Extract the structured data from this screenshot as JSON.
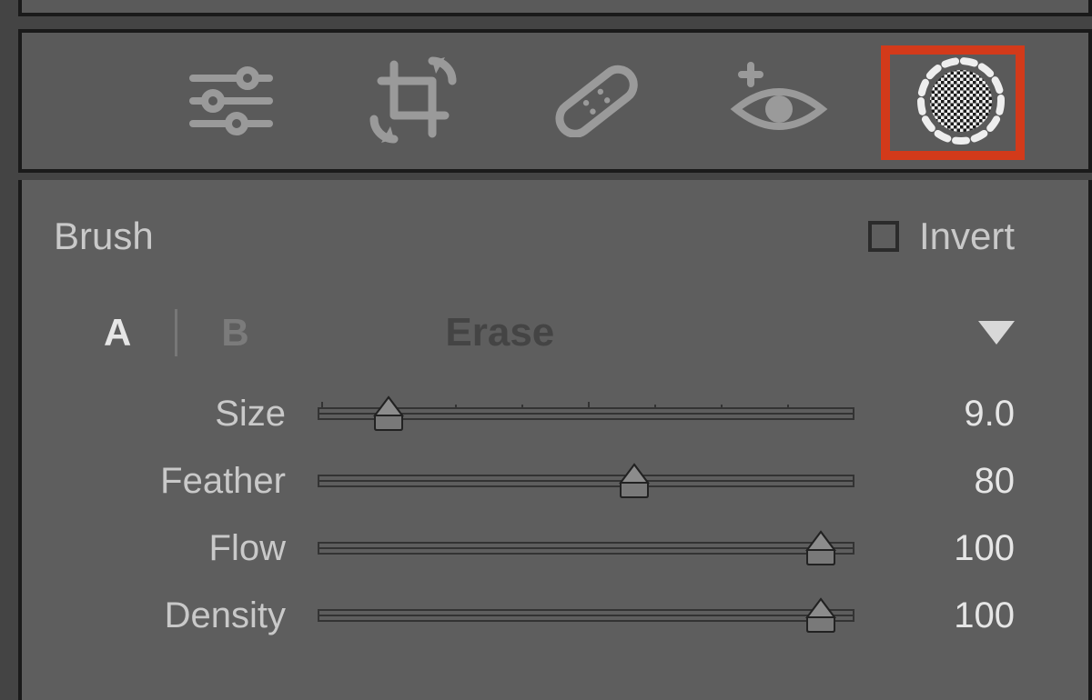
{
  "panel_title": "Brush",
  "invert": {
    "label": "Invert",
    "checked": false
  },
  "modes": {
    "a": "A",
    "b": "B",
    "erase": "Erase",
    "active": "A"
  },
  "sliders": {
    "size": {
      "label": "Size",
      "value": "9.0",
      "pos": 13,
      "ticks": true
    },
    "feather": {
      "label": "Feather",
      "value": "80",
      "pos": 59,
      "ticks": false
    },
    "flow": {
      "label": "Flow",
      "value": "100",
      "pos": 94,
      "ticks": false
    },
    "density": {
      "label": "Density",
      "value": "100",
      "pos": 94,
      "ticks": false
    }
  },
  "toolbar": {
    "tools": [
      "edit-sliders",
      "crop",
      "heal",
      "redeye",
      "masking"
    ],
    "active": "masking",
    "highlighted": "masking"
  },
  "colors": {
    "highlight": "#d33a1a",
    "panel": "#5e5e5e",
    "text": "#c9c9c9"
  }
}
